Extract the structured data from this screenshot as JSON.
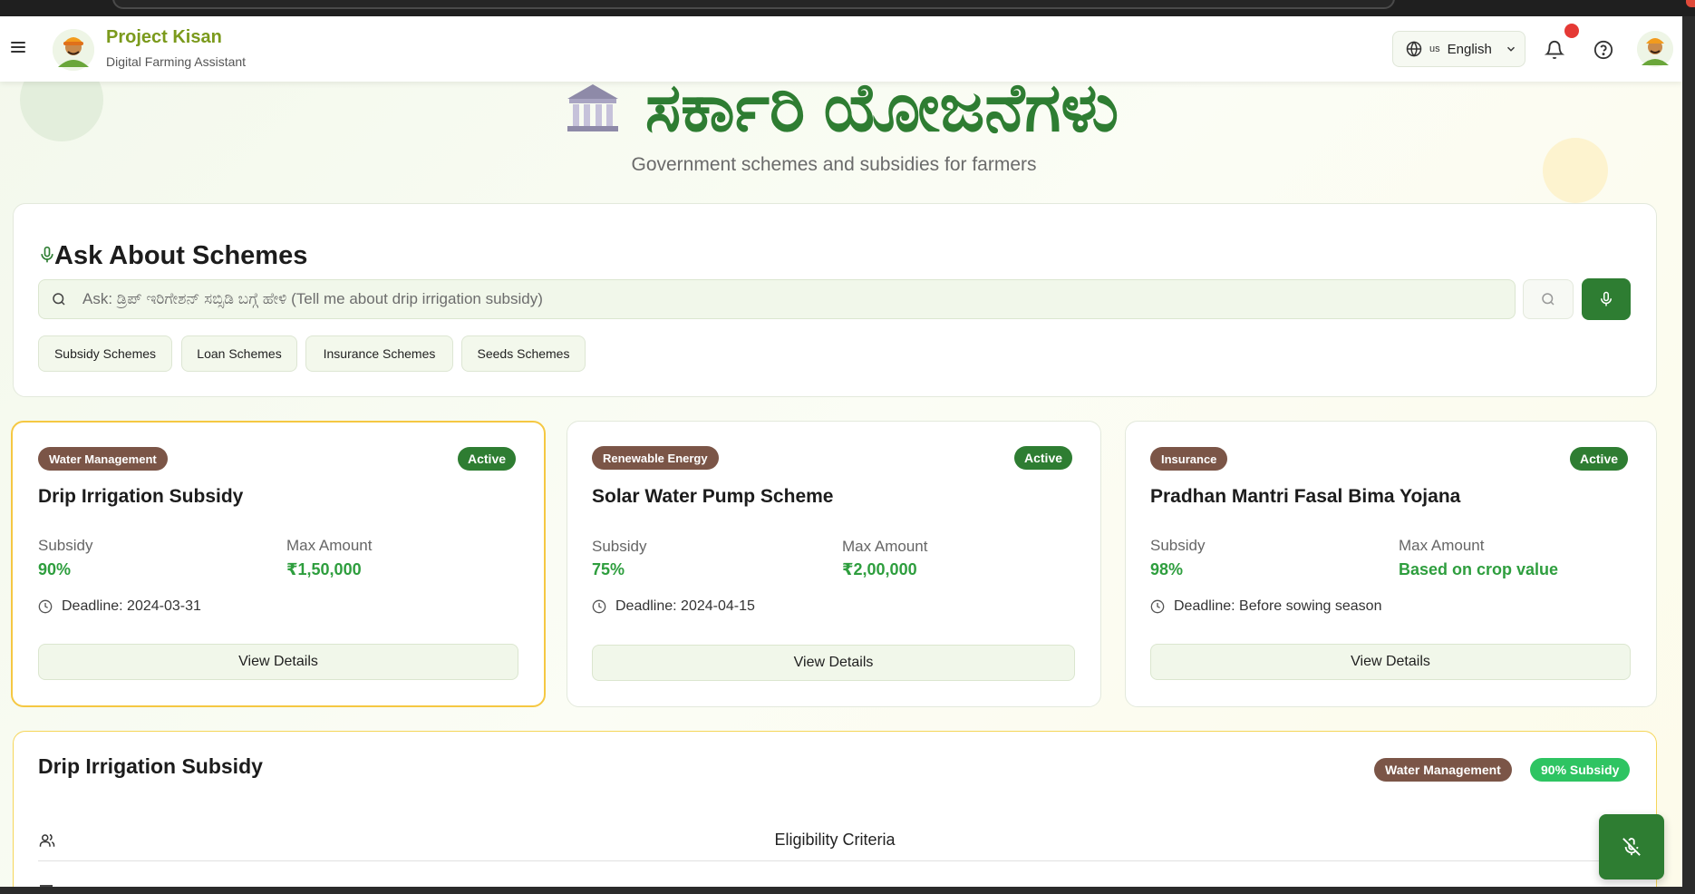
{
  "header": {
    "brand_title": "Project Kisan",
    "brand_subtitle": "Digital Farming Assistant",
    "language_flag": "us",
    "language_label": "English"
  },
  "hero": {
    "title": "ಸರ್ಕಾರಿ ಯೋಜನೆಗಳು",
    "subtitle": "Government schemes and subsidies for farmers"
  },
  "ask": {
    "title": "Ask About Schemes",
    "placeholder": "Ask: ಡ್ರಿಪ್ ಇರಿಗೇಶನ್ ಸಬ್ಸಿಡಿ ಬಗ್ಗೆ ಹೇಳಿ (Tell me about drip irrigation subsidy)",
    "chips": [
      "Subsidy Schemes",
      "Loan Schemes",
      "Insurance Schemes",
      "Seeds Schemes"
    ]
  },
  "schemes": [
    {
      "category": "Water Management",
      "status": "Active",
      "title": "Drip Irrigation Subsidy",
      "subsidy_label": "Subsidy",
      "subsidy_value": "90%",
      "max_label": "Max Amount",
      "max_value": "₹1,50,000",
      "deadline": "Deadline: 2024-03-31",
      "button": "View Details"
    },
    {
      "category": "Renewable Energy",
      "status": "Active",
      "title": "Solar Water Pump Scheme",
      "subsidy_label": "Subsidy",
      "subsidy_value": "75%",
      "max_label": "Max Amount",
      "max_value": "₹2,00,000",
      "deadline": "Deadline: 2024-04-15",
      "button": "View Details"
    },
    {
      "category": "Insurance",
      "status": "Active",
      "title": "Pradhan Mantri Fasal Bima Yojana",
      "subsidy_label": "Subsidy",
      "subsidy_value": "98%",
      "max_label": "Max Amount",
      "max_value": "Based on crop value",
      "deadline": "Deadline: Before sowing season",
      "button": "View Details"
    }
  ],
  "detail": {
    "title": "Drip Irrigation Subsidy",
    "category": "Water Management",
    "subsidy_badge": "90% Subsidy",
    "section_eligibility": "Eligibility Criteria"
  },
  "colors": {
    "primary_green": "#2e7d32",
    "accent_green": "#2e9e3e",
    "brown_badge": "#7b5547",
    "selected_border": "#f5c842",
    "notification": "#e53935"
  }
}
